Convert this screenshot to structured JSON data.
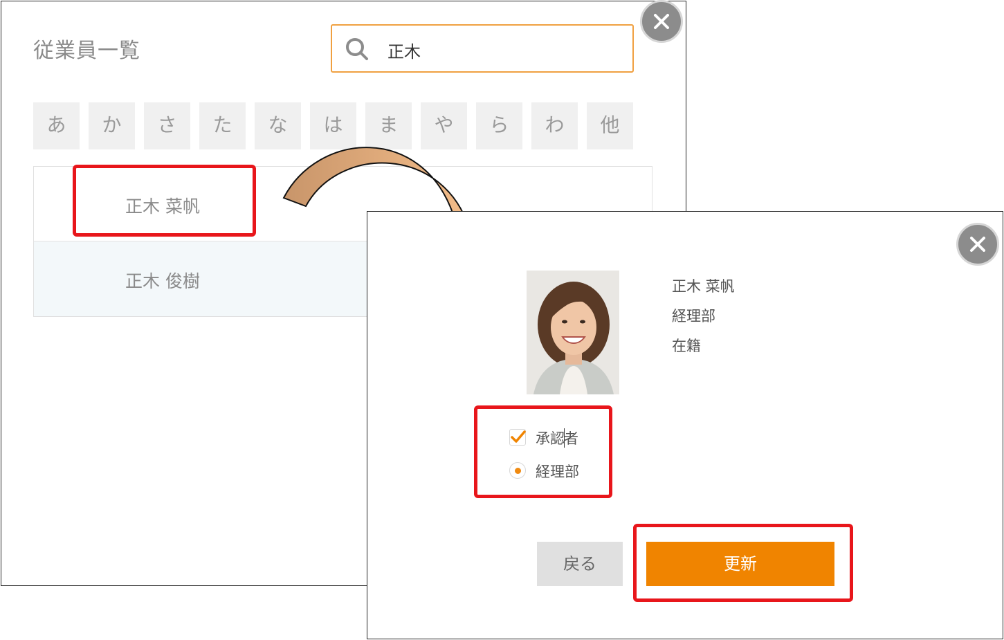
{
  "list_panel": {
    "title": "従業員一覧",
    "search": {
      "value": "正木"
    },
    "kana_filters": [
      "あ",
      "か",
      "さ",
      "た",
      "な",
      "は",
      "ま",
      "や",
      "ら",
      "わ",
      "他"
    ],
    "results": [
      {
        "name": "正木 菜帆"
      },
      {
        "name": "正木 俊樹"
      }
    ],
    "close_label": "×"
  },
  "edit_panel": {
    "employee": {
      "name": "正木 菜帆",
      "department": "経理部",
      "status": "在籍"
    },
    "approver_checkbox": {
      "label_before_caret": "承認",
      "label_after_caret": "者",
      "checked": true
    },
    "department_radio": {
      "label": "経理部",
      "selected": true
    },
    "back_label": "戻る",
    "update_label": "更新",
    "close_label": "×"
  },
  "colors": {
    "accent_orange": "#f08400",
    "highlight_red": "#e8161b",
    "arrow_fill": "#f5b87c"
  }
}
